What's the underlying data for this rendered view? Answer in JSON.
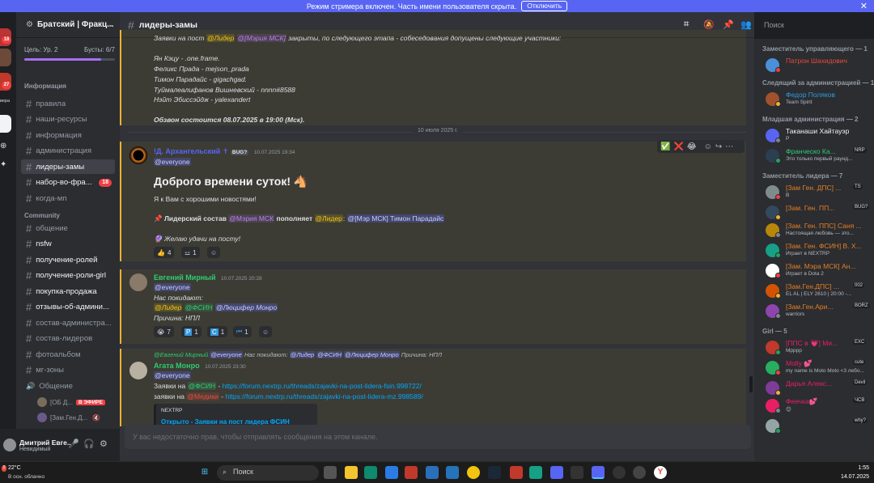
{
  "banner": {
    "text": "Режим стримера включен. Часть имени пользователя скрыта.",
    "button": "Отключить",
    "close": "✕"
  },
  "servers": {
    "badges": [
      "18",
      "27"
    ],
    "labels": [
      "верa"
    ]
  },
  "server_name": "Братский | Фракц...",
  "boost": {
    "goal": "Цель: Ур. 2",
    "boosts": "Бусты: 6/7"
  },
  "channels": {
    "cat_info": "Информация",
    "cat_community": "Community",
    "info": [
      {
        "label": "правила"
      },
      {
        "label": "наши-ресурсы"
      },
      {
        "label": "информация"
      },
      {
        "label": "администрация"
      },
      {
        "label": "лидеры-замы"
      },
      {
        "label": "набор-во-фра...",
        "badge": "18"
      },
      {
        "label": "когда-мп"
      }
    ],
    "community": [
      {
        "label": "общение"
      },
      {
        "label": "nsfw"
      },
      {
        "label": "получение-ролей"
      },
      {
        "label": "получение-роли-girl"
      },
      {
        "label": "покупка-продажа"
      },
      {
        "label": "отзывы-об-админи..."
      },
      {
        "label": "состав-администра..."
      },
      {
        "label": "состав-лидеров"
      },
      {
        "label": "фотоальбом"
      },
      {
        "label": "мг-зоны"
      },
      {
        "label": "Общение"
      }
    ],
    "voice": [
      {
        "name": "[ОБ Д...",
        "live": "В ЭФИРЕ"
      },
      {
        "name": "[Зам.Ген.Д..."
      }
    ]
  },
  "user": {
    "name": "Дмитрий Евге...",
    "status": "Невидимый"
  },
  "header": {
    "channel": "лидеры-замы"
  },
  "search": {
    "placeholder": "Поиск"
  },
  "messages": {
    "m0": {
      "line1a": "Заявки на пост",
      "line1role": "@Лидер",
      "line1role2": "@[Мэрия МСК]",
      "line1b": "закрыты, по следующего этапа - собеседования допущены следующие участники:",
      "names": [
        "Ян Кэцу - .one.frame.",
        "Феликс Прада - mejson_prada",
        "Тимон Парадайс - gigachgad.",
        "Туймалеалифанов Вишневский - nnnn#8588",
        "Нэйт Эбиссэйдж - yalexandert"
      ],
      "final": "Обзвон состоится 08.07.2025 в 19:00 (Мск)."
    },
    "date_sep": "10 июля 2025 г.",
    "m1": {
      "author": "!Д. Архангельский ✝",
      "tag": "BUG?",
      "time": "10.07.2025 19:34",
      "everyone": "@everyone",
      "greeting": "Доброго времени суток!",
      "intro": "Я к Вам с хорошими новостями!",
      "line_a": "Лидерский состав",
      "line_role": "@Мэрия МСК",
      "line_b": "пополняет",
      "line_role2": "@Лидер",
      "line_colon": ":",
      "line_mention": "@[Мэр МСК] Тимон Парадайс",
      "wish": "Желаю удачи на посту!",
      "reactions": [
        {
          "emoji": "👍",
          "count": "4"
        },
        {
          "emoji": "⚍",
          "count": "1"
        }
      ]
    },
    "m2": {
      "author": "Евгений Мирный",
      "time": "10.07.2025 20:28",
      "everyone": "@everyone",
      "leaving": "Нас покидают:",
      "role1": "@Лидер",
      "role2": "@ФСИН",
      "role3": "@Люцифер Монро",
      "reason": "Причина: НПЛ",
      "reactions": [
        {
          "emoji": "😭",
          "count": "7"
        },
        {
          "emoji": "P",
          "count": "1"
        },
        {
          "emoji": "C",
          "count": "1"
        },
        {
          "emoji": "⏮",
          "count": "1"
        }
      ]
    },
    "m3": {
      "reply_author": "@Евгений Мирный",
      "reply_mention": "@everyone",
      "reply_text": "Нас покидают:",
      "reply_r1": "@Лидер",
      "reply_r2": "@ФСИН",
      "reply_r3": "@Люцифер Монро",
      "reply_reason": "Причина: НПЛ",
      "author": "Агата Монро",
      "time": "10.07.2025 23:30",
      "everyone": "@everyone",
      "l1a": "Заявки на",
      "l1role": "@ФСИН",
      "l1link": "https://forum.nextrp.ru/threads/zajavki-na-post-lidera-fsin.998722/",
      "l2a": "заявки на",
      "l2role": "@Медики",
      "l2link": "https://forum.nextrp.ru/threads/zajavki-na-post-lidera-mz.998589/",
      "embed_site": "NEXTRP",
      "embed_title": "Открыто - Заявки на пост лидера ФСИН"
    }
  },
  "composer": {
    "placeholder": "У вас недостаточно прав, чтобы отправлять сообщения на этом канале."
  },
  "members": {
    "groups": [
      {
        "title": "Заместитель управляющего — 1",
        "items": [
          {
            "name": "Патрон Шахидович",
            "color": "#e74c3c"
          }
        ]
      },
      {
        "title": "Следящий за администрацией — 1",
        "items": [
          {
            "name": "Федор Поляков",
            "color": "#3498db",
            "sub": "Team Spirit"
          }
        ]
      },
      {
        "title": "Младшая администрация — 2",
        "items": [
          {
            "name": "Таканаши Хайтауэр",
            "color": "#f2f3f5",
            "sub": "P"
          },
          {
            "name": "Франческо Ка...",
            "color": "#2ecc71",
            "tag": "NRP",
            "sub": "Это только первый раунд..."
          }
        ]
      },
      {
        "title": "Заместитель лидера — 7",
        "items": [
          {
            "name": "[Зам Ген. ДПС] ...",
            "color": "#e67e22",
            "tag": "TS",
            "sub": "B"
          },
          {
            "name": "[Зам. Ген. ПП...",
            "color": "#e67e22",
            "tag": "BUG?"
          },
          {
            "name": "[Зам. Ген. ППС] Саня ...",
            "color": "#e67e22",
            "sub": "Настоящая любовь — это..."
          },
          {
            "name": "[Зам. Ген. ФСИН] В. Х...",
            "color": "#e67e22",
            "sub": "Играет в NEXTRP"
          },
          {
            "name": "[Зам. Мэра МСК] Ан...",
            "color": "#e67e22",
            "sub": "Играет в Dota 2"
          },
          {
            "name": "[Зам.Ген.ДПС] ...",
            "color": "#e67e22",
            "tag": "002",
            "sub": "EL AL | ELY 2610 | 20:00 -..."
          },
          {
            "name": "[Зам.Ген.Ари...",
            "color": "#e67e22",
            "tag": "BORZ",
            "sub": "warriors"
          }
        ]
      },
      {
        "title": "Girl — 5",
        "items": [
          {
            "name": "[ППС в 💗] Ми...",
            "color": "#e91e63",
            "tag": "EXC",
            "sub": "Мрррр"
          },
          {
            "name": "Molly 💕",
            "color": "#e91e63",
            "tag": "cute",
            "sub": "my name is Moto Moto <3 лебо..."
          },
          {
            "name": "Дарья Алекс...",
            "color": "#e91e63",
            "tag": "Devil"
          },
          {
            "name": "Феечка💕",
            "color": "#e91e63",
            "tag": "ЧСВ",
            "sub": "😊"
          },
          {
            "name": "",
            "color": "#e91e63",
            "tag": "why?"
          }
        ]
      }
    ]
  },
  "taskbar": {
    "weather_temp": "22°C",
    "weather_desc": "В осн. облачно",
    "search": "Поиск",
    "time": "1:55",
    "date": "14.07.2025",
    "badge": "2"
  }
}
